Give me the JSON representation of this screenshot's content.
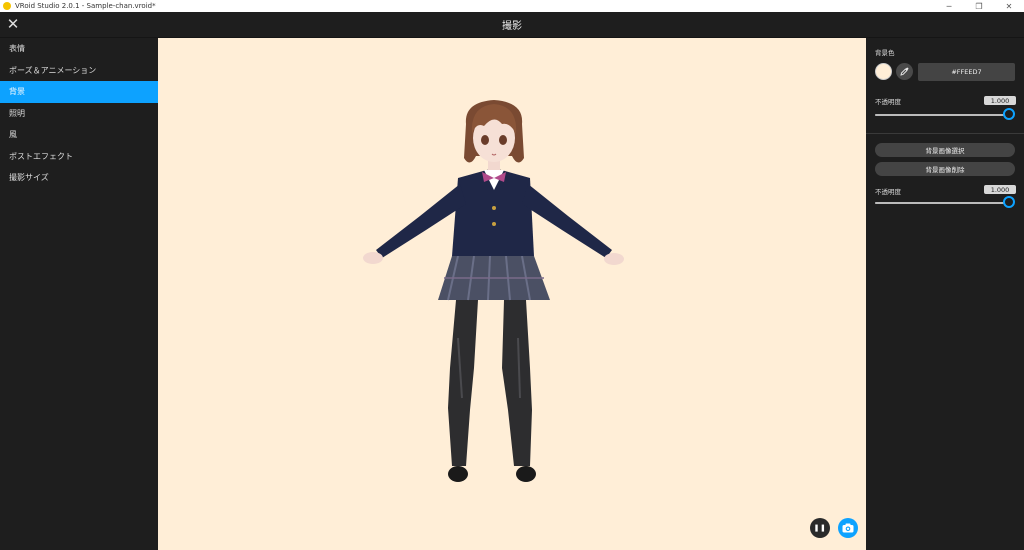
{
  "window": {
    "title": "VRoid Studio 2.0.1 - Sample-chan.vroid*"
  },
  "header": {
    "title": "撮影"
  },
  "sidebar": {
    "items": [
      {
        "label": "表情",
        "active": false
      },
      {
        "label": "ポーズ＆アニメーション",
        "active": false
      },
      {
        "label": "背景",
        "active": true
      },
      {
        "label": "照明",
        "active": false
      },
      {
        "label": "風",
        "active": false
      },
      {
        "label": "ポストエフェクト",
        "active": false
      },
      {
        "label": "撮影サイズ",
        "active": false
      }
    ]
  },
  "background_panel": {
    "color_label": "背景色",
    "color_hex": "#FFEED7",
    "opacity_label": "不透明度",
    "opacity_value": "1.000",
    "opacity_fraction": 1.0,
    "select_image_label": "背景画像選択",
    "delete_image_label": "背景画像削除",
    "image_opacity_label": "不透明度",
    "image_opacity_value": "1.000",
    "image_opacity_fraction": 1.0
  },
  "icons": {
    "close": "close-icon",
    "eyedropper": "eyedropper-icon",
    "pause": "pause-icon",
    "camera": "camera-icon"
  },
  "colors": {
    "accent": "#0da2ff",
    "viewport_bg": "#ffeed7",
    "panel_bg": "#1e1e1e"
  }
}
